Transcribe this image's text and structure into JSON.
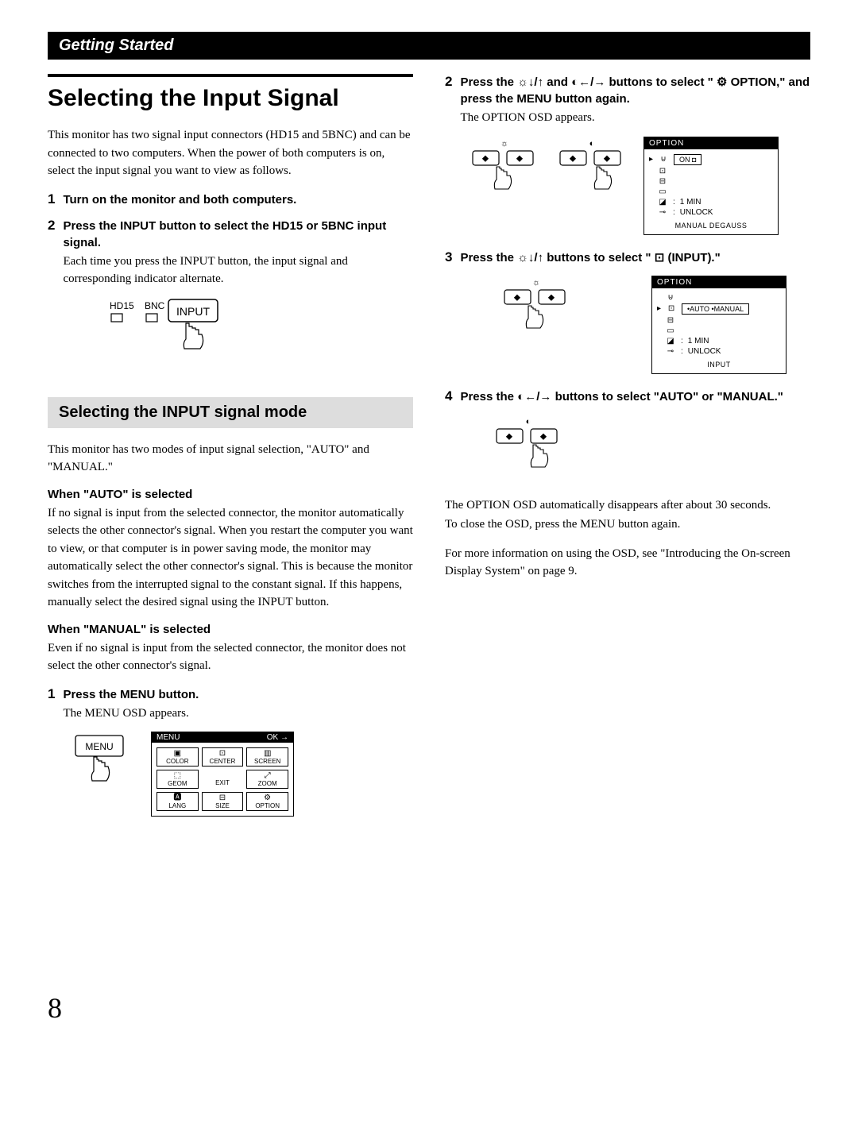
{
  "section_header": "Getting Started",
  "left": {
    "main_title": "Selecting the Input Signal",
    "intro": "This monitor has two signal input connectors (HD15 and 5BNC) and can be connected to two computers. When the power of both computers is on, select the input signal you want to view as follows.",
    "step1": {
      "num": "1",
      "title": "Turn on the monitor and both computers."
    },
    "step2": {
      "num": "2",
      "title": "Press the INPUT button to select the HD15 or 5BNC input signal.",
      "desc": "Each time you press the INPUT button, the input signal and corresponding indicator alternate."
    },
    "diagram_input": {
      "hd15": "HD15",
      "bnc": "BNC",
      "input": "INPUT"
    },
    "sub_heading": "Selecting the INPUT signal mode",
    "sub_intro": "This monitor has two modes of input signal selection, \"AUTO\" and \"MANUAL.\"",
    "auto_heading": "When \"AUTO\" is selected",
    "auto_body": "If no signal is input from the selected connector, the monitor automatically selects the other connector's signal. When you restart the computer you want to view, or that computer is in power saving mode, the monitor may automatically select the other connector's signal.  This is because the monitor switches from the interrupted signal to the constant signal. If this happens, manually select the desired signal using the INPUT button.",
    "manual_heading": "When \"MANUAL\" is selected",
    "manual_body": "Even if no signal is input from the selected connector, the monitor does not select the other connector's signal.",
    "step_menu": {
      "num": "1",
      "title": "Press the MENU button.",
      "desc": "The MENU OSD appears."
    },
    "menu_btn": "MENU",
    "menu_osd": {
      "title": "MENU",
      "ok": "OK →",
      "cells": [
        "COLOR",
        "CENTER",
        "SCREEN",
        "GEOM",
        "EXIT",
        "ZOOM",
        "LANG",
        "SIZE",
        "OPTION"
      ]
    }
  },
  "right": {
    "step2": {
      "num": "2",
      "title_a": "Press the ☼↓/↑ and ◐←/→ buttons to select \" ",
      "title_b": " OPTION,\" and press the MENU button again.",
      "desc": "The OPTION OSD appears."
    },
    "osd1": {
      "title": "OPTION",
      "on": "ON ◘",
      "one_min": "1 MIN",
      "unlock": "UNLOCK",
      "bottom": "MANUAL DEGAUSS"
    },
    "step3": {
      "num": "3",
      "title": "Press the ☼↓/↑ buttons to select \" ⊡  (INPUT).\""
    },
    "osd2": {
      "title": "OPTION",
      "auto_manual": "•AUTO  •MANUAL",
      "one_min": "1 MIN",
      "unlock": "UNLOCK",
      "bottom": "INPUT"
    },
    "step4": {
      "num": "4",
      "title": "Press the ◐←/→ buttons to select \"AUTO\" or \"MANUAL.\""
    },
    "outro1": "The OPTION OSD automatically disappears after about 30 seconds.",
    "outro2": "To close the OSD, press the MENU button again.",
    "outro3": "For more information on using the OSD, see \"Introducing the On-screen Display System\" on page 9."
  },
  "page_number": "8"
}
